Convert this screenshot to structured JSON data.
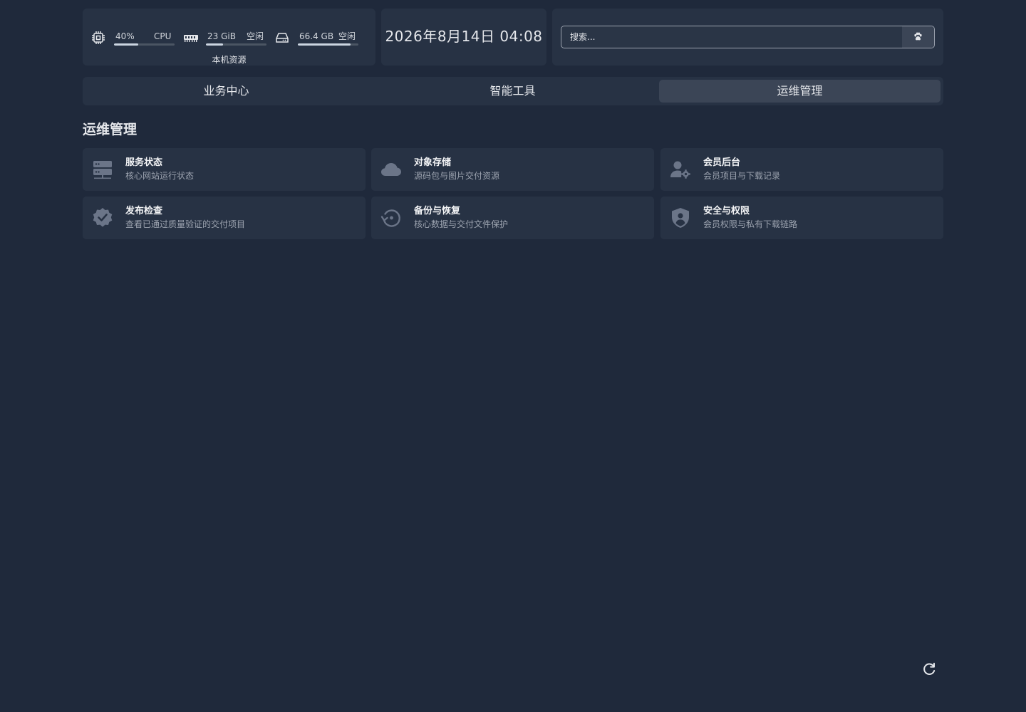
{
  "resources": {
    "title": "本机资源",
    "cpu": {
      "value": "40%",
      "label": "CPU",
      "usage": 0.4
    },
    "memory": {
      "value": "23 GiB",
      "label": "空闲",
      "usage": 0.28
    },
    "disk": {
      "value": "66.4 GB",
      "label": "空闲",
      "usage": 0.87
    }
  },
  "clock": {
    "text": "2026年8月14日 04:08"
  },
  "search": {
    "placeholder": "搜索..."
  },
  "tabs": [
    {
      "label": "业务中心",
      "active": false
    },
    {
      "label": "智能工具",
      "active": false
    },
    {
      "label": "运维管理",
      "active": true
    }
  ],
  "section": {
    "title": "运维管理",
    "services": [
      {
        "name": "服务状态",
        "description": "核心网站运行状态",
        "icon": "server-icon"
      },
      {
        "name": "对象存储",
        "description": "源码包与图片交付资源",
        "icon": "cloud-icon"
      },
      {
        "name": "会员后台",
        "description": "会员项目与下载记录",
        "icon": "user-gear-icon"
      },
      {
        "name": "发布检查",
        "description": "查看已通过质量验证的交付项目",
        "icon": "verified-badge-icon"
      },
      {
        "name": "备份与恢复",
        "description": "核心数据与交付文件保护",
        "icon": "backup-restore-icon"
      },
      {
        "name": "安全与权限",
        "description": "会员权限与私有下载链路",
        "icon": "shield-user-icon"
      }
    ]
  },
  "colors": {
    "background": "#1f293b",
    "card": "#273244",
    "active_tab": "#3b4556",
    "icon": "#6b7588",
    "muted_text": "#9ca3af"
  }
}
